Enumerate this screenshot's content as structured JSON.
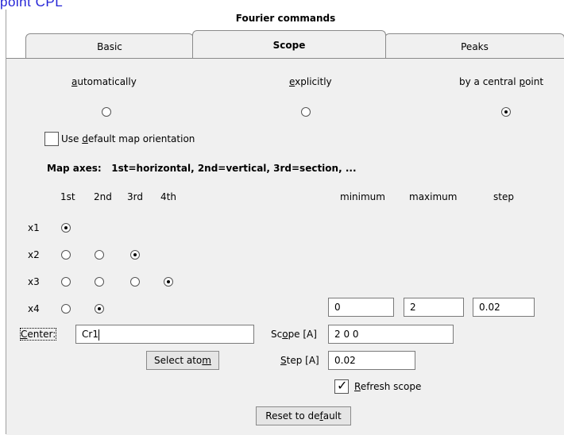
{
  "page_heading_fragment": "point CPL",
  "window": {
    "title": "Fourier commands"
  },
  "tabs": [
    {
      "label": "Basic",
      "active": false
    },
    {
      "label": "Scope",
      "active": true
    },
    {
      "label": "Peaks",
      "active": false
    }
  ],
  "scope_mode": {
    "options": [
      {
        "pre": "",
        "u": "a",
        "post": "utomatically",
        "selected": false
      },
      {
        "pre": "",
        "u": "e",
        "post": "xplicitly",
        "selected": false
      },
      {
        "pre": "by a central ",
        "u": "p",
        "post": "oint",
        "selected": true
      }
    ]
  },
  "default_orientation": {
    "pre": "Use ",
    "u": "d",
    "post": "efault map orientation",
    "checked": false
  },
  "map_axes_label": "Map axes:   1st=horizontal, 2nd=vertical, 3rd=section, ...",
  "axis_columns": [
    "1st",
    "2nd",
    "3rd",
    "4th"
  ],
  "range_columns": {
    "min": "minimum",
    "max": "maximum",
    "step": "step"
  },
  "rows": [
    {
      "label": "x1",
      "selected": 0,
      "count": 1
    },
    {
      "label": "x2",
      "selected": 2,
      "count": 3
    },
    {
      "label": "x3",
      "selected": 3,
      "count": 4
    },
    {
      "label": "x4",
      "selected": 1,
      "count": 2
    }
  ],
  "x4_range": {
    "minimum": "0",
    "maximum": "2",
    "step": "0.02"
  },
  "center": {
    "pre": "",
    "u": "C",
    "post": "enter:",
    "value": "Cr1"
  },
  "select_atom_button": {
    "pre": "Select ato",
    "u": "m",
    "post": ""
  },
  "scope_field": {
    "pre": "Sc",
    "u": "o",
    "post": "pe [A]",
    "value": "2 0 0"
  },
  "step_field": {
    "pre": "",
    "u": "S",
    "post": "tep [A]",
    "value": "0.02"
  },
  "refresh_scope": {
    "pre": "",
    "u": "R",
    "post": "efresh scope",
    "checked": true
  },
  "reset_button": {
    "pre": "Reset to de",
    "u": "f",
    "post": "ault"
  }
}
